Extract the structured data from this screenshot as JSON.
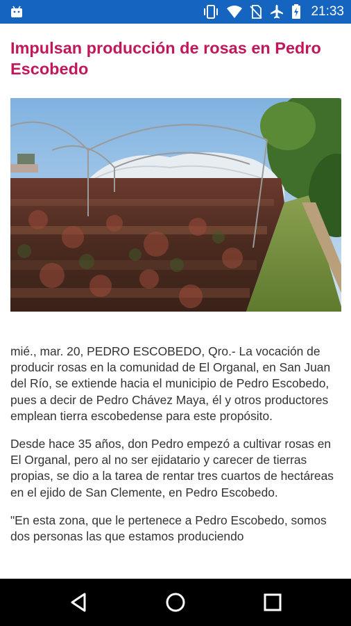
{
  "status_bar": {
    "time": "21:33",
    "icons": [
      "android-icon",
      "vibrate-icon",
      "wifi-icon",
      "no-sim-icon",
      "airplane-mode-icon",
      "battery-charging-icon"
    ]
  },
  "article": {
    "title": "Impulsan producción de rosas en Pedro Escobedo",
    "paragraphs": [
      "mié., mar. 20, PEDRO ESCOBEDO, Qro.- La vocación de producir rosas en la comunidad de El Organal, en San Juan del Río, se extiende hacia el municipio de Pedro Escobedo, pues a decir de Pedro Chávez Maya, él y otros productores emplean tierra escobedense para este propósito.",
      "Desde hace 35 años, don Pedro empezó a cultivar rosas en El Organal, pero al no ser ejidatario y carecer de tierras propias, se dio a la tarea de rentar tres cuartos de hectáreas en el ejido de San Clemente, en Pedro Escobedo.",
      "\"En esta zona, que le pertenece a Pedro Escobedo, somos dos personas las que estamos produciendo"
    ]
  },
  "nav_bar": {
    "buttons": [
      "back-icon",
      "home-icon",
      "recents-icon"
    ]
  },
  "colors": {
    "status_bar": "#1565c0",
    "title": "#c2185b",
    "text": "#333333",
    "nav_bar": "#000000"
  }
}
